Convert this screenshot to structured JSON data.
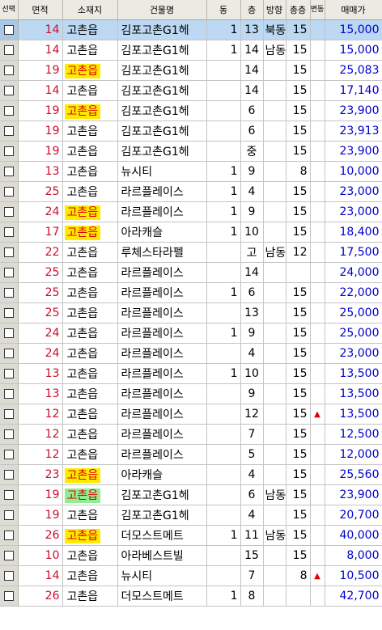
{
  "headers": {
    "select": "선택",
    "area": "면적",
    "location": "소재지",
    "building": "건물명",
    "dong": "동",
    "floor": "층",
    "direction": "방향",
    "total_floors": "총층",
    "change": "변동",
    "price": "매매가"
  },
  "rows": [
    {
      "area": "14",
      "location": "고촌읍",
      "loc_highlight": "",
      "building": "김포고촌G1헤",
      "dong": "1",
      "floor": "13",
      "direction": "북동",
      "total_floors": "15",
      "change": "",
      "price": "15,000",
      "selected": true
    },
    {
      "area": "14",
      "location": "고촌읍",
      "loc_highlight": "",
      "building": "김포고촌G1헤",
      "dong": "1",
      "floor": "14",
      "direction": "남동",
      "total_floors": "15",
      "change": "",
      "price": "15,000",
      "selected": false
    },
    {
      "area": "19",
      "location": "고촌읍",
      "loc_highlight": "yellow",
      "building": "김포고촌G1헤",
      "dong": "",
      "floor": "14",
      "direction": "",
      "total_floors": "15",
      "change": "",
      "price": "25,083",
      "selected": false
    },
    {
      "area": "14",
      "location": "고촌읍",
      "loc_highlight": "",
      "building": "김포고촌G1헤",
      "dong": "",
      "floor": "14",
      "direction": "",
      "total_floors": "15",
      "change": "",
      "price": "17,140",
      "selected": false
    },
    {
      "area": "19",
      "location": "고촌읍",
      "loc_highlight": "yellow",
      "building": "김포고촌G1헤",
      "dong": "",
      "floor": "6",
      "direction": "",
      "total_floors": "15",
      "change": "",
      "price": "23,900",
      "selected": false
    },
    {
      "area": "19",
      "location": "고촌읍",
      "loc_highlight": "",
      "building": "김포고촌G1헤",
      "dong": "",
      "floor": "6",
      "direction": "",
      "total_floors": "15",
      "change": "",
      "price": "23,913",
      "selected": false
    },
    {
      "area": "19",
      "location": "고촌읍",
      "loc_highlight": "",
      "building": "김포고촌G1헤",
      "dong": "",
      "floor": "중",
      "direction": "",
      "total_floors": "15",
      "change": "",
      "price": "23,900",
      "selected": false
    },
    {
      "area": "13",
      "location": "고촌읍",
      "loc_highlight": "",
      "building": "뉴시티",
      "dong": "1",
      "floor": "9",
      "direction": "",
      "total_floors": "8",
      "change": "",
      "price": "10,000",
      "selected": false
    },
    {
      "area": "25",
      "location": "고촌읍",
      "loc_highlight": "",
      "building": "라르플레이스",
      "dong": "1",
      "floor": "4",
      "direction": "",
      "total_floors": "15",
      "change": "",
      "price": "23,000",
      "selected": false
    },
    {
      "area": "24",
      "location": "고촌읍",
      "loc_highlight": "yellow",
      "building": "라르플레이스",
      "dong": "1",
      "floor": "9",
      "direction": "",
      "total_floors": "15",
      "change": "",
      "price": "23,000",
      "selected": false
    },
    {
      "area": "17",
      "location": "고촌읍",
      "loc_highlight": "yellow",
      "building": "아라캐슬",
      "dong": "1",
      "floor": "10",
      "direction": "",
      "total_floors": "15",
      "change": "",
      "price": "18,400",
      "selected": false
    },
    {
      "area": "22",
      "location": "고촌읍",
      "loc_highlight": "",
      "building": "루체스타라펠",
      "dong": "",
      "floor": "고",
      "direction": "남동",
      "total_floors": "12",
      "change": "",
      "price": "17,500",
      "selected": false
    },
    {
      "area": "25",
      "location": "고촌읍",
      "loc_highlight": "",
      "building": "라르플레이스",
      "dong": "",
      "floor": "14",
      "direction": "",
      "total_floors": "",
      "change": "",
      "price": "24,000",
      "selected": false
    },
    {
      "area": "25",
      "location": "고촌읍",
      "loc_highlight": "",
      "building": "라르플레이스",
      "dong": "1",
      "floor": "6",
      "direction": "",
      "total_floors": "15",
      "change": "",
      "price": "22,000",
      "selected": false
    },
    {
      "area": "25",
      "location": "고촌읍",
      "loc_highlight": "",
      "building": "라르플레이스",
      "dong": "",
      "floor": "13",
      "direction": "",
      "total_floors": "15",
      "change": "",
      "price": "25,000",
      "selected": false
    },
    {
      "area": "24",
      "location": "고촌읍",
      "loc_highlight": "",
      "building": "라르플레이스",
      "dong": "1",
      "floor": "9",
      "direction": "",
      "total_floors": "15",
      "change": "",
      "price": "25,000",
      "selected": false
    },
    {
      "area": "24",
      "location": "고촌읍",
      "loc_highlight": "",
      "building": "라르플레이스",
      "dong": "",
      "floor": "4",
      "direction": "",
      "total_floors": "15",
      "change": "",
      "price": "23,000",
      "selected": false
    },
    {
      "area": "13",
      "location": "고촌읍",
      "loc_highlight": "",
      "building": "라르플레이스",
      "dong": "1",
      "floor": "10",
      "direction": "",
      "total_floors": "15",
      "change": "",
      "price": "13,500",
      "selected": false
    },
    {
      "area": "13",
      "location": "고촌읍",
      "loc_highlight": "",
      "building": "라르플레이스",
      "dong": "",
      "floor": "9",
      "direction": "",
      "total_floors": "15",
      "change": "",
      "price": "13,500",
      "selected": false
    },
    {
      "area": "12",
      "location": "고촌읍",
      "loc_highlight": "",
      "building": "라르플레이스",
      "dong": "",
      "floor": "12",
      "direction": "",
      "total_floors": "15",
      "change": "▲",
      "price": "13,500",
      "selected": false
    },
    {
      "area": "12",
      "location": "고촌읍",
      "loc_highlight": "",
      "building": "라르플레이스",
      "dong": "",
      "floor": "7",
      "direction": "",
      "total_floors": "15",
      "change": "",
      "price": "12,500",
      "selected": false
    },
    {
      "area": "12",
      "location": "고촌읍",
      "loc_highlight": "",
      "building": "라르플레이스",
      "dong": "",
      "floor": "5",
      "direction": "",
      "total_floors": "15",
      "change": "",
      "price": "12,000",
      "selected": false
    },
    {
      "area": "23",
      "location": "고촌읍",
      "loc_highlight": "yellow",
      "building": "아라캐슬",
      "dong": "",
      "floor": "4",
      "direction": "",
      "total_floors": "15",
      "change": "",
      "price": "25,560",
      "selected": false
    },
    {
      "area": "19",
      "location": "고촌읍",
      "loc_highlight": "green",
      "building": "김포고촌G1헤",
      "dong": "",
      "floor": "6",
      "direction": "남동",
      "total_floors": "15",
      "change": "",
      "price": "23,900",
      "selected": false
    },
    {
      "area": "19",
      "location": "고촌읍",
      "loc_highlight": "",
      "building": "김포고촌G1헤",
      "dong": "",
      "floor": "4",
      "direction": "",
      "total_floors": "15",
      "change": "",
      "price": "20,700",
      "selected": false
    },
    {
      "area": "26",
      "location": "고촌읍",
      "loc_highlight": "yellow",
      "building": "더모스트메트",
      "dong": "1",
      "floor": "11",
      "direction": "남동",
      "total_floors": "15",
      "change": "",
      "price": "40,000",
      "selected": false
    },
    {
      "area": "10",
      "location": "고촌읍",
      "loc_highlight": "",
      "building": "아라베스트빌",
      "dong": "",
      "floor": "15",
      "direction": "",
      "total_floors": "15",
      "change": "",
      "price": "8,000",
      "selected": false
    },
    {
      "area": "14",
      "location": "고촌읍",
      "loc_highlight": "",
      "building": "뉴시티",
      "dong": "",
      "floor": "7",
      "direction": "",
      "total_floors": "8",
      "change": "▲",
      "price": "10,500",
      "selected": false
    },
    {
      "area": "26",
      "location": "고촌읍",
      "loc_highlight": "",
      "building": "더모스트메트",
      "dong": "1",
      "floor": "8",
      "direction": "",
      "total_floors": "",
      "change": "",
      "price": "42,700",
      "selected": false
    }
  ]
}
